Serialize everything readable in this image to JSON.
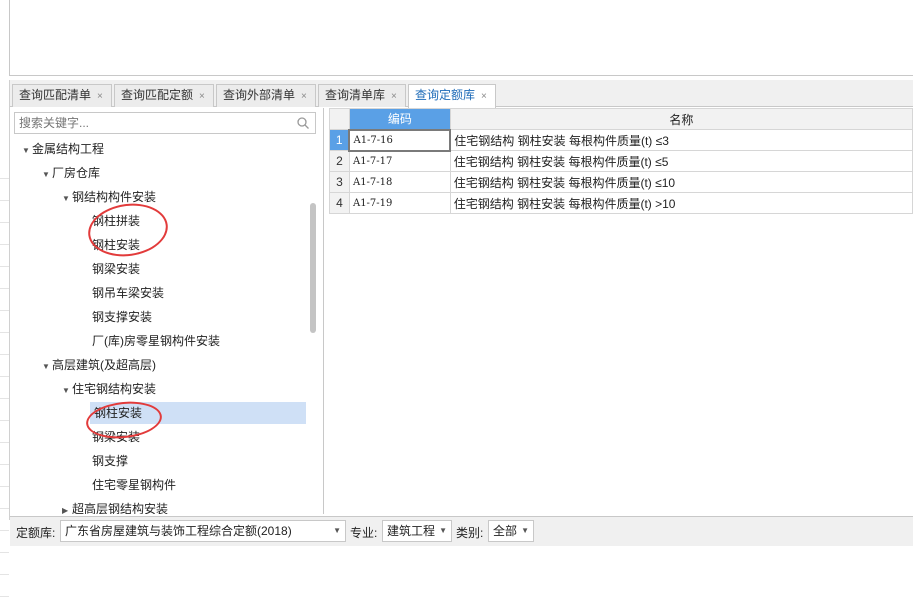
{
  "tabs": [
    {
      "label": "查询匹配清单",
      "close": "×"
    },
    {
      "label": "查询匹配定额",
      "close": "×"
    },
    {
      "label": "查询外部清单",
      "close": "×"
    },
    {
      "label": "查询清单库",
      "close": "×"
    },
    {
      "label": "查询定额库",
      "close": "×",
      "active": true
    }
  ],
  "search": {
    "placeholder": "搜索关键字..."
  },
  "tree": [
    {
      "label": "金属结构工程",
      "level": 0,
      "expanded": true
    },
    {
      "label": "厂房仓库",
      "level": 1,
      "expanded": true
    },
    {
      "label": "钢结构构件安装",
      "level": 2,
      "expanded": true
    },
    {
      "label": "钢柱拼装",
      "level": 3
    },
    {
      "label": "钢柱安装",
      "level": 3
    },
    {
      "label": "钢梁安装",
      "level": 3
    },
    {
      "label": "钢吊车梁安装",
      "level": 3
    },
    {
      "label": "钢支撑安装",
      "level": 3
    },
    {
      "label": "厂(库)房零星钢构件安装",
      "level": 3
    },
    {
      "label": "高层建筑(及超高层)",
      "level": 1,
      "expanded": true
    },
    {
      "label": "住宅钢结构安装",
      "level": 2,
      "expanded": true
    },
    {
      "label": "钢柱安装",
      "level": 3,
      "selected": true
    },
    {
      "label": "钢梁安装",
      "level": 3
    },
    {
      "label": "钢支撑",
      "level": 3
    },
    {
      "label": "住宅零星钢构件",
      "level": 3
    },
    {
      "label": "超高层钢结构安装",
      "level": 2,
      "expanded": false
    }
  ],
  "grid": {
    "headers": {
      "code": "编码",
      "name": "名称"
    },
    "rows": [
      {
        "idx": "1",
        "code": "A1-7-16",
        "name": "住宅钢结构 钢柱安装 每根构件质量(t) ≤3"
      },
      {
        "idx": "2",
        "code": "A1-7-17",
        "name": "住宅钢结构 钢柱安装 每根构件质量(t) ≤5"
      },
      {
        "idx": "3",
        "code": "A1-7-18",
        "name": "住宅钢结构 钢柱安装 每根构件质量(t) ≤10"
      },
      {
        "idx": "4",
        "code": "A1-7-19",
        "name": "住宅钢结构 钢柱安装 每根构件质量(t) >10"
      }
    ]
  },
  "statusbar": {
    "quota_label": "定额库:",
    "quota_value": "广东省房屋建筑与装饰工程综合定额(2018)",
    "major_label": "专业:",
    "major_value": "建筑工程",
    "category_label": "类别:",
    "category_value": "全部"
  },
  "colors": {
    "accent": "#5aa0e6",
    "selected_row": "#cfe0f6",
    "annotation": "#e23b3b",
    "active_tab_text": "#1e6bb8"
  }
}
